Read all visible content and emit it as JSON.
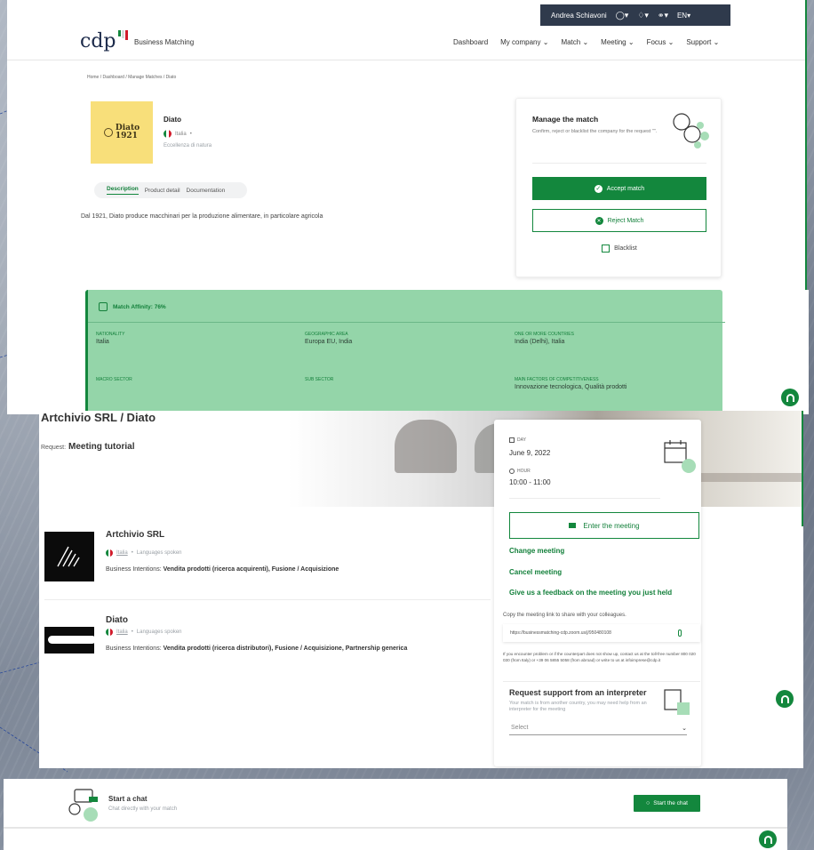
{
  "header": {
    "user_name": "Andrea Schiavoni",
    "lang": "EN",
    "logo_text": "cdp",
    "brand_sub": "Business Matching",
    "nav": [
      "Dashboard",
      "My company",
      "Match",
      "Meeting",
      "Focus",
      "Support"
    ]
  },
  "breadcrumb": "Home / Dashboard / Manage Matches / Diato",
  "company": {
    "logo_text": "Diato",
    "logo_year": "1921",
    "name": "Diato",
    "country": "Italia",
    "tagline": "Eccellenza di natura",
    "tabs": [
      "Description",
      "Product detail",
      "Documentation"
    ],
    "description": "Dal 1921, Diato produce macchinari per la produzione alimentare, in particolare agricola"
  },
  "manage": {
    "title": "Manage the match",
    "text": "Confirm, reject or blacklist the company for the request \"\".",
    "accept": "Accept match",
    "reject": "Reject Match",
    "blacklist": "Blacklist"
  },
  "affinity": {
    "title": "Match Affinity: 76%",
    "fields": [
      {
        "label": "NATIONALITY",
        "value": "Italia"
      },
      {
        "label": "GEOGRAPHIC AREA",
        "value": "Europa EU, India"
      },
      {
        "label": "ONE OR MORE COUNTRIES",
        "value": "India (Delhi), Italia"
      },
      {
        "label": "MACRO SECTOR",
        "value": ""
      },
      {
        "label": "SUB SECTOR",
        "value": ""
      },
      {
        "label": "MAIN FACTORS OF COMPETITIVENESS",
        "value": "Innovazione tecnologica, Qualità prodotti"
      }
    ]
  },
  "meeting": {
    "title": "Artchivio SRL / Diato",
    "request_prefix": "Request:",
    "request_name": "Meeting tutorial",
    "day_label": "DAY",
    "day": "June 9, 2022",
    "hour_label": "HOUR",
    "hour": "10:00 - 11:00",
    "enter": "Enter the meeting",
    "change": "Change meeting",
    "cancel": "Cancel meeting",
    "feedback": "Give us a feedback on the meeting you just held",
    "copy_label": "Copy the meeting link to share with your colleagues.",
    "link": "https://businessmatching-cdp.zoom.us/j/950480108",
    "problem": "If you encounter problem or if the counterpart does not show up, contact us at the toll-free number 800 020 030 (from Italy) or +39 06 5855 5058 (from abroad) or write to us at infoimprese@cdp.it",
    "support_title": "Request support from an interpreter",
    "support_text": "Your match is from another country, you may need help from an interpreter for the meeting",
    "select_placeholder": "Select",
    "participants": [
      {
        "name": "Artchivio SRL",
        "country": "Italia",
        "languages": "Languages spoken",
        "intent_label": "Business Intentions:",
        "intents": "Vendita prodotti (ricerca acquirenti), Fusione / Acquisizione"
      },
      {
        "name": "Diato",
        "country": "Italia",
        "languages": "Languages spoken",
        "intent_label": "Business Intentions:",
        "intents": "Vendita prodotti (ricerca distributori), Fusione / Acquisizione, Partnership generica"
      }
    ]
  },
  "chat": {
    "title": "Start a chat",
    "subtitle": "Chat directly with your match",
    "button": "Start the chat"
  },
  "colors": {
    "accent": "#13873d",
    "affinity_bg": "#94d5a9",
    "logo_bg": "#f8df7a",
    "dark_bar": "#2f3a4c"
  },
  "icons": [
    "user-icon",
    "bell-icon",
    "share-icon",
    "flag-it-icon",
    "check-circle-icon",
    "x-circle-icon",
    "blacklist-icon",
    "handshake-icon",
    "calendar-icon",
    "clock-icon",
    "video-icon",
    "clip-icon",
    "interpreter-icon",
    "chat-icon",
    "headset-icon"
  ]
}
